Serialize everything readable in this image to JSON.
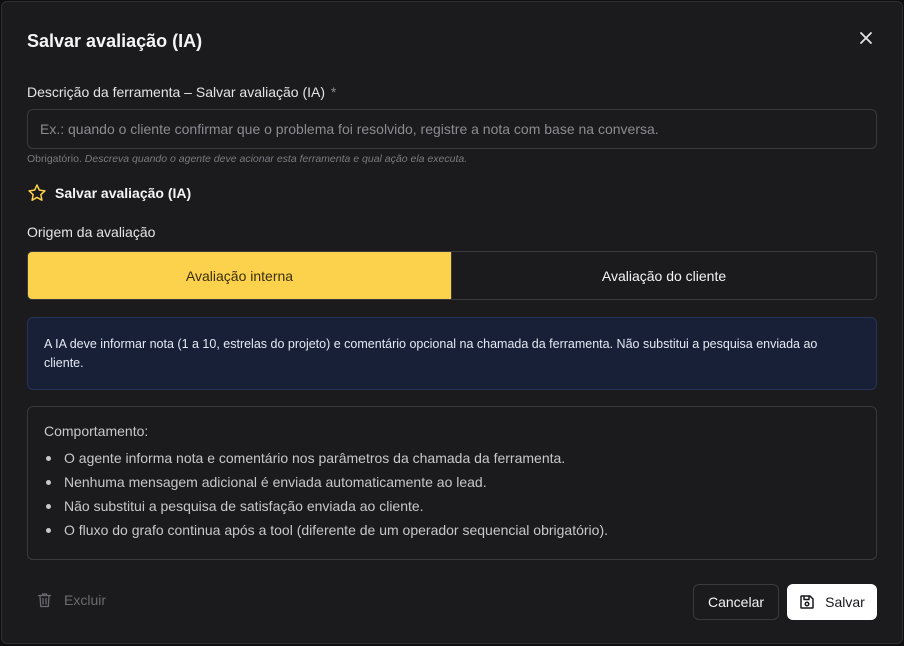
{
  "dialog": {
    "title": "Salvar avaliação (IA)",
    "close_icon": "close-icon"
  },
  "description_field": {
    "label": "Descrição da ferramenta – Salvar avaliação (IA)",
    "required_marker": "*",
    "value": "",
    "placeholder": "Ex.: quando o cliente confirmar que o problema foi resolvido, registre a nota com base na conversa.",
    "hint_prefix": "Obrigatório.",
    "hint_text": "Descreva quando o agente deve acionar esta ferramenta e qual ação ela executa."
  },
  "tool": {
    "icon": "star-icon",
    "name": "Salvar avaliação (IA)"
  },
  "origin": {
    "label": "Origem da avaliação",
    "options": [
      "Avaliação interna",
      "Avaliação do cliente"
    ],
    "selected": "Avaliação interna"
  },
  "info": {
    "text": "A IA deve informar nota (1 a 10, estrelas do projeto) e comentário opcional na chamada da ferramenta. Não substitui a pesquisa enviada ao cliente."
  },
  "behavior": {
    "title": "Comportamento:",
    "items": [
      "O agente informa nota e comentário nos parâmetros da chamada da ferramenta.",
      "Nenhuma mensagem adicional é enviada automaticamente ao lead.",
      "Não substitui a pesquisa de satisfação enviada ao cliente.",
      "O fluxo do grafo continua após a tool (diferente de um operador sequencial obrigatório)."
    ]
  },
  "footer": {
    "delete_label": "Excluir",
    "cancel_label": "Cancelar",
    "save_label": "Salvar"
  },
  "colors": {
    "accent": "#fcd14b",
    "background": "#1b1b1d",
    "info_bg": "#172037"
  }
}
